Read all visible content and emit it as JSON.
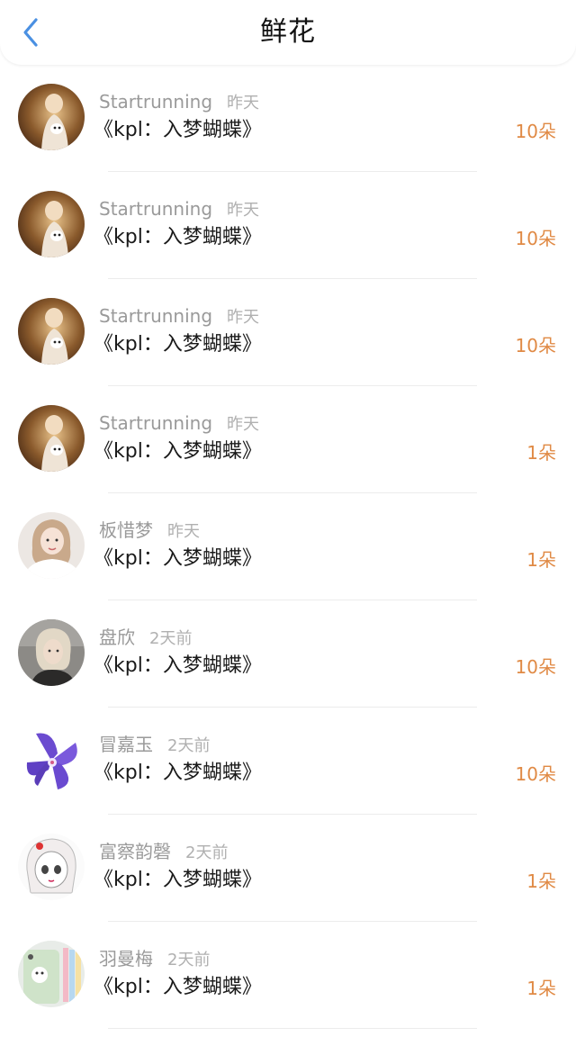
{
  "header": {
    "title": "鲜花",
    "back_icon": "chevron-left-icon",
    "accent_color": "#4a90e2"
  },
  "amount_color": "#e08a45",
  "items": [
    {
      "name": "Startrunning",
      "time": "昨天",
      "novel": "《kpl：入梦蝴蝶》",
      "amount": "10朵",
      "avatar": "portrait-sepia"
    },
    {
      "name": "Startrunning",
      "time": "昨天",
      "novel": "《kpl：入梦蝴蝶》",
      "amount": "10朵",
      "avatar": "portrait-sepia"
    },
    {
      "name": "Startrunning",
      "time": "昨天",
      "novel": "《kpl：入梦蝴蝶》",
      "amount": "10朵",
      "avatar": "portrait-sepia"
    },
    {
      "name": "Startrunning",
      "time": "昨天",
      "novel": "《kpl：入梦蝴蝶》",
      "amount": "1朵",
      "avatar": "portrait-sepia"
    },
    {
      "name": "板惜梦",
      "time": "昨天",
      "novel": "《kpl：入梦蝴蝶》",
      "amount": "1朵",
      "avatar": "portrait-girl-white"
    },
    {
      "name": "盘欣",
      "time": "2天前",
      "novel": "《kpl：入梦蝴蝶》",
      "amount": "10朵",
      "avatar": "portrait-blonde"
    },
    {
      "name": "冒嘉玉",
      "time": "2天前",
      "novel": "《kpl：入梦蝴蝶》",
      "amount": "10朵",
      "avatar": "purple-orchid"
    },
    {
      "name": "富察韵磬",
      "time": "2天前",
      "novel": "《kpl：入梦蝴蝶》",
      "amount": "1朵",
      "avatar": "anime-sketch"
    },
    {
      "name": "羽曼梅",
      "time": "2天前",
      "novel": "《kpl：入梦蝴蝶》",
      "amount": "1朵",
      "avatar": "phone-cases"
    }
  ]
}
